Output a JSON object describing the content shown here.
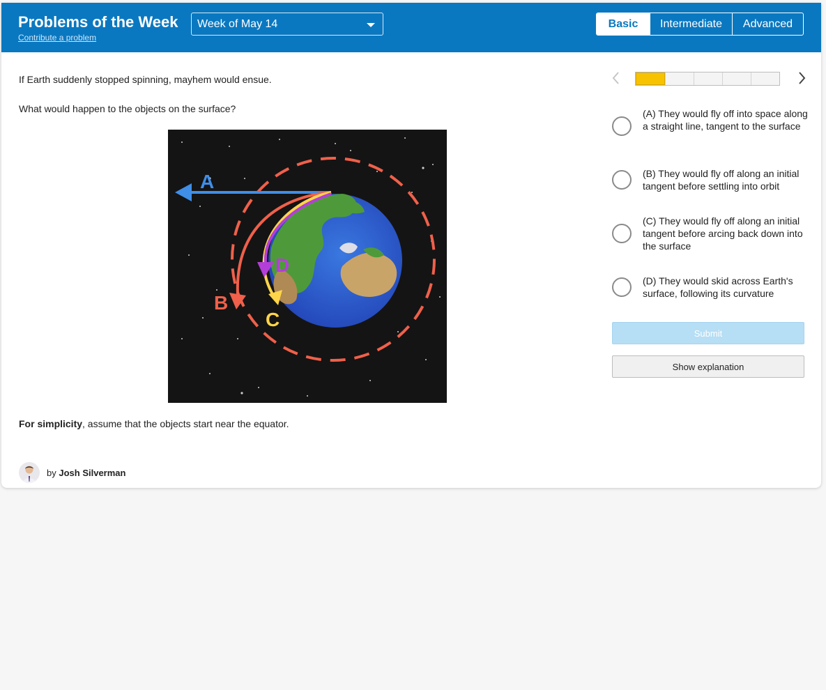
{
  "header": {
    "title": "Problems of the Week",
    "contribute_link": "Contribute a problem",
    "week_select": "Week of May 14",
    "levels": [
      "Basic",
      "Intermediate",
      "Advanced"
    ],
    "active_level": "Basic"
  },
  "question": {
    "line1": "If Earth suddenly stopped spinning, mayhem would ensue.",
    "line2": "What would happen to the objects on the surface?",
    "figure_labels": {
      "a": "A",
      "b": "B",
      "c": "C",
      "d": "D"
    },
    "note_bold": "For simplicity",
    "note_rest": ", assume that the objects start near the equator."
  },
  "author": {
    "prefix": "by",
    "name": "Josh Silverman"
  },
  "progress": {
    "current": 1,
    "total": 5
  },
  "options": [
    {
      "label": "(A) They would fly off into space along a straight line, tangent to the surface"
    },
    {
      "label": "(B) They would fly off along an initial tangent before settling into orbit"
    },
    {
      "label": "(C) They would fly off along an initial tangent before arcing back down into the surface"
    },
    {
      "label": "(D) They would skid across Earth's surface, following its curvature"
    }
  ],
  "buttons": {
    "submit": "Submit",
    "explanation": "Show explanation"
  },
  "colors": {
    "header_bg": "#0a78c0",
    "progress_fill": "#f7c300",
    "arrow_a": "#3f8ee8",
    "arrow_b": "#f0604a",
    "arrow_c": "#ffd54a",
    "arrow_d": "#b43ed8"
  }
}
